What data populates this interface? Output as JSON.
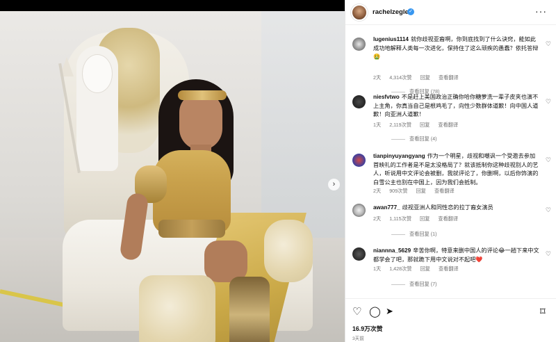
{
  "post": {
    "username": "rachelzegler",
    "more_icon": "more-horizontal-icon"
  },
  "comments": [
    {
      "username": "lugenius1114",
      "text": "就你歧视亚裔啊，你到底找到了什么诀窍，能如此成功地解释人类每一次进化，保持住了这么顽疾的愚蠢？依托答辩🤮",
      "time": "2天",
      "likes": "4,314次赞",
      "reply": "回复",
      "translate": "查看翻译",
      "replies": "查看回复 (78)"
    },
    {
      "username": "niesfvtwo",
      "text": "不是赶上美国政治正确你哈你糖萝洗一辈子皮夹也演不上主角，你真当自己是根鸡毛了，向性少数群体道歉！向中国人道歉！向亚洲人道歉！",
      "time": "1天",
      "likes": "2,119次赞",
      "reply": "回复",
      "translate": "查看翻译",
      "replies": "查看回复 (4)"
    },
    {
      "username": "tianpinyuyangyang",
      "text": "作为一个明星，歧视和嘲讽一个受邀去参加首映礼的工作者是不是太没格局了？就该抵制你这种歧视别人的艺人，听说用中文评论会被删，我就评论了，你删啊，以后你饰演的白雪公主也别在中国上，因为我们会抵制。",
      "time": "2天",
      "likes": "909次赞",
      "reply": "回复",
      "translate": "查看翻译",
      "replies": ""
    },
    {
      "username": "awan777_",
      "text": "歧视亚洲人和同性恋的拉丁裔女演员",
      "time": "2天",
      "likes": "1,115次赞",
      "reply": "回复",
      "translate": "查看翻译",
      "replies": "查看回复 (1)"
    },
    {
      "username": "niannna_5629",
      "text": "辛苦你啊，特意来删中国人的评论😂一趟下来中文都学会了吧，那就跪下用中文说对不起吧❤️",
      "time": "1天",
      "likes": "1,428次赞",
      "reply": "回复",
      "translate": "查看翻译",
      "replies": "查看回复 (7)"
    }
  ],
  "actions": {
    "likes": "16.9万次赞",
    "date": "3天前"
  },
  "icons": {
    "like": "heart-icon",
    "comment": "comment-icon",
    "share": "share-icon",
    "save": "bookmark-icon",
    "next": "chevron-right-icon"
  }
}
